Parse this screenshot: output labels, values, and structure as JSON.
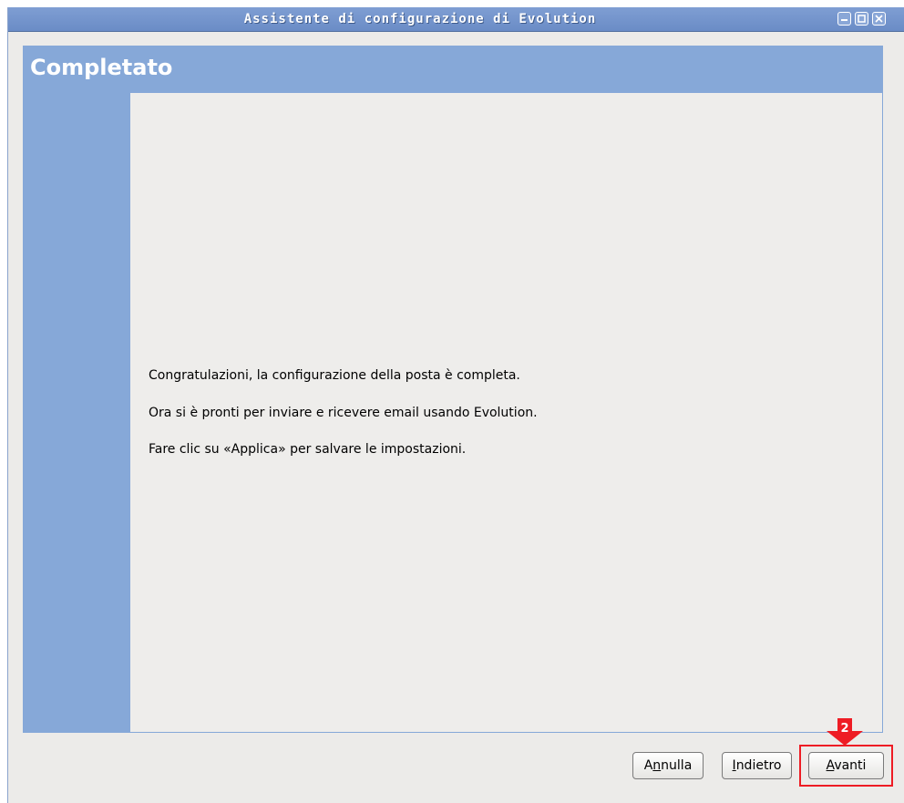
{
  "window": {
    "title": "Assistente di configurazione di Evolution",
    "controls": [
      "minimize-icon",
      "maximize-icon",
      "close-icon"
    ]
  },
  "page": {
    "heading": "Completato",
    "messages": [
      "Congratulazioni, la configurazione della posta è completa.",
      "Ora si è pronti per inviare e ricevere email usando Evolution.",
      "Fare clic su «Applica» per salvare le impostazioni."
    ]
  },
  "buttons": {
    "cancel": {
      "mnemonic": "n",
      "before": "A",
      "after": "nulla"
    },
    "back": {
      "mnemonic": "I",
      "before": "",
      "after": "ndietro"
    },
    "next": {
      "mnemonic": "A",
      "before": "",
      "after": "vanti"
    }
  },
  "annotation": {
    "step_number": "2",
    "color": "#ee1c24"
  },
  "colors": {
    "accent": "#86a8d8",
    "titlebar": "#7f9ed3",
    "background": "#ecebe9"
  }
}
